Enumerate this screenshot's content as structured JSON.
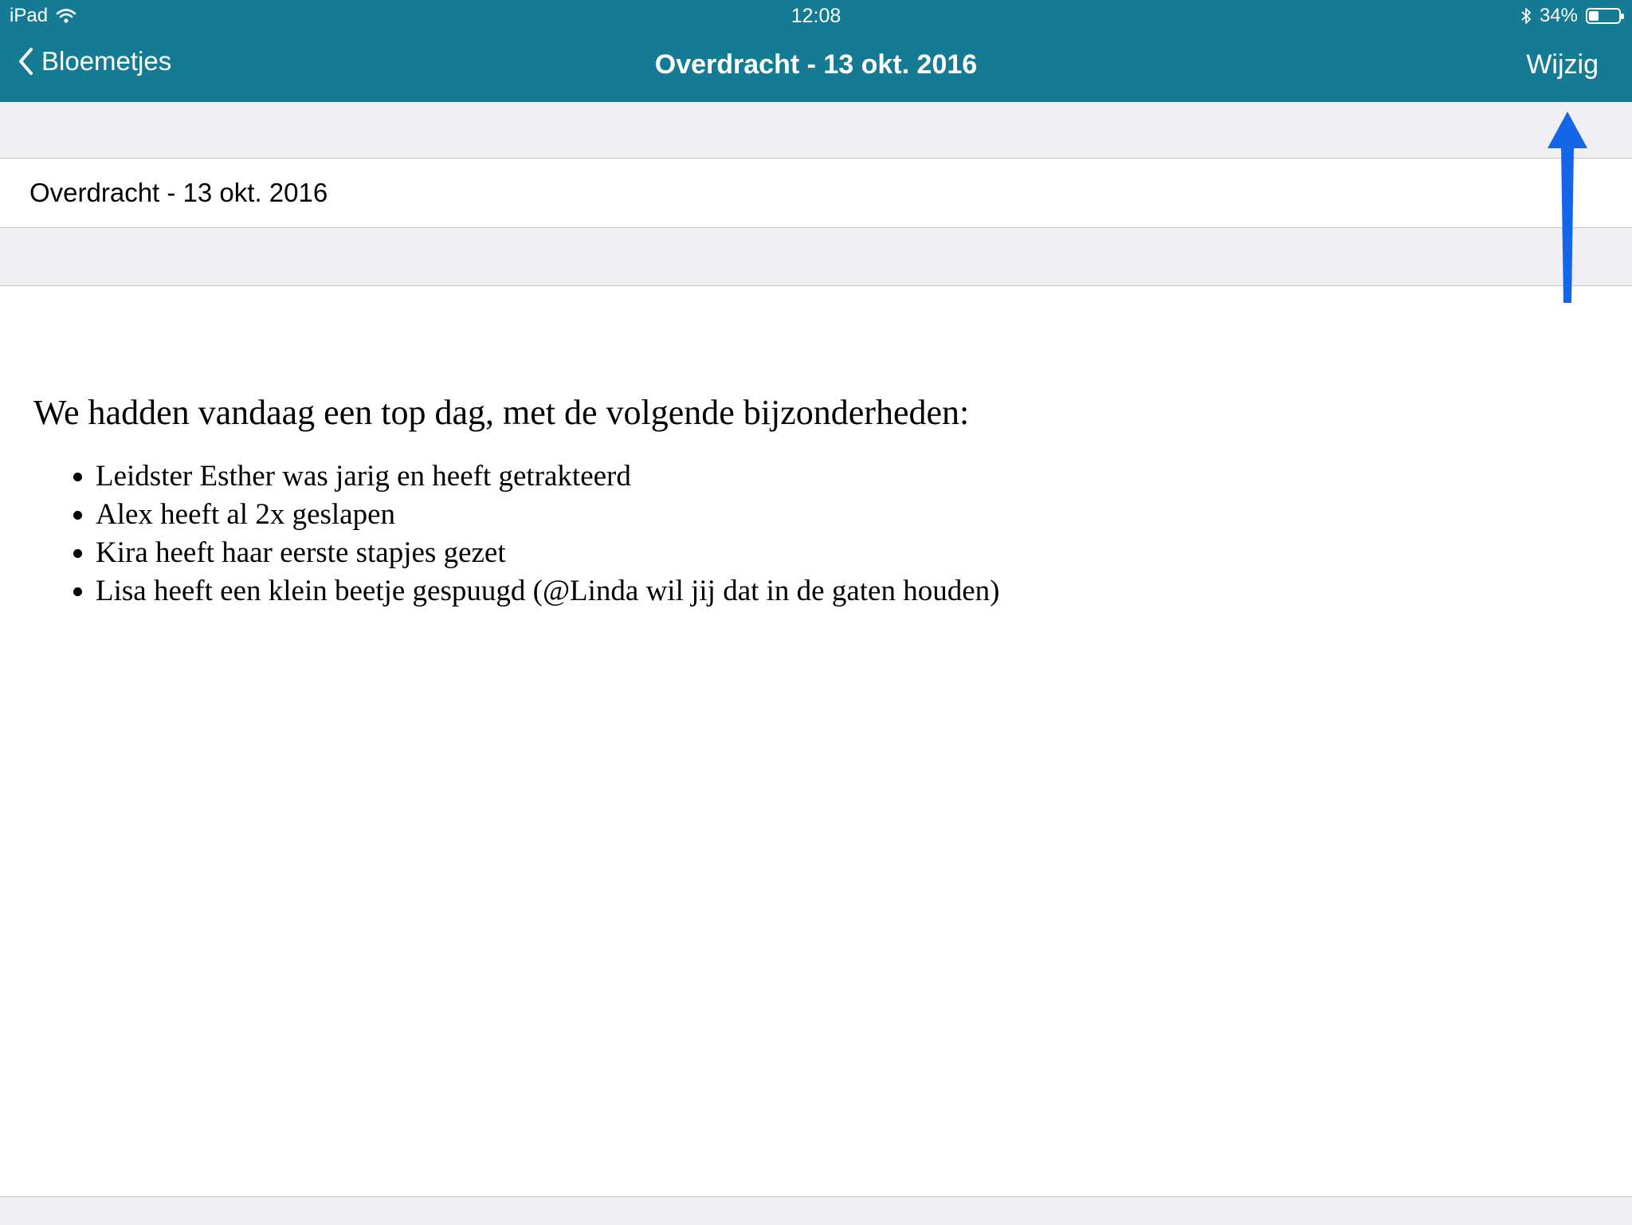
{
  "status_bar": {
    "device": "iPad",
    "time": "12:08",
    "battery": "34%",
    "battery_level": 0.34,
    "icons": [
      "wifi-icon",
      "bluetooth-icon",
      "battery-icon"
    ]
  },
  "nav": {
    "back_label": "Bloemetjes",
    "title": "Overdracht - 13 okt. 2016",
    "edit_label": "Wijzig"
  },
  "note": {
    "title": "Overdracht - 13 okt. 2016",
    "intro": "We hadden vandaag een top dag, met de volgende bijzonderheden:",
    "items": [
      "Leidster Esther was jarig en heeft getrakteerd",
      "Alex heeft al 2x geslapen",
      "Kira heeft haar eerste stapjes gezet",
      "Lisa heeft een klein beetje gespuugd (@Linda wil jij dat in de gaten houden)"
    ]
  },
  "colors": {
    "nav_background": "#157a93",
    "group_background": "#efeff4",
    "annotation_arrow": "#1565e8"
  }
}
